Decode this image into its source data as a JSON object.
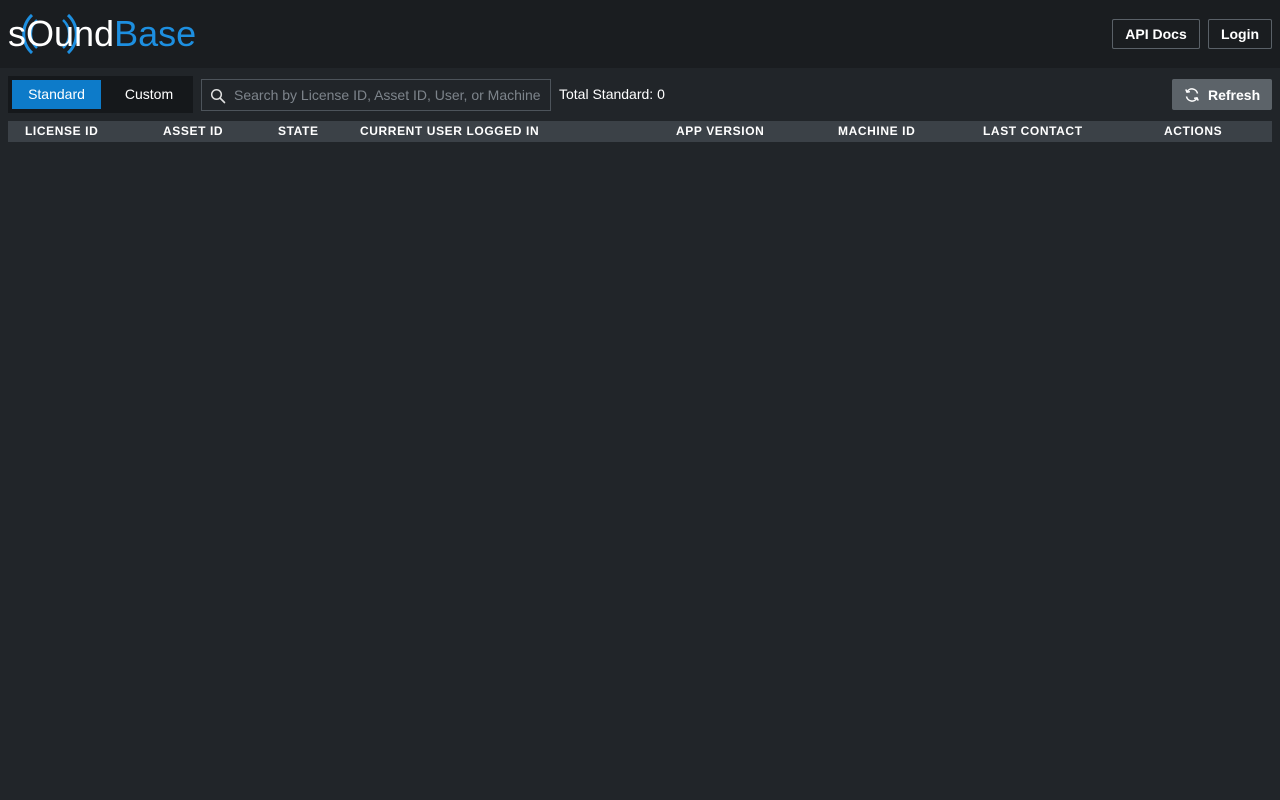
{
  "header": {
    "logo": {
      "part1": "s",
      "part2": "O",
      "part3": "und",
      "part4": "Base",
      "brand_color": "#1d8fe0"
    },
    "api_docs_label": "API Docs",
    "login_label": "Login"
  },
  "toolbar": {
    "toggle": {
      "standard_label": "Standard",
      "custom_label": "Custom",
      "selected": "Standard",
      "accent": "#0d7bc9"
    },
    "search": {
      "placeholder": "Search by License ID, Asset ID, User, or Machine ID",
      "value": "",
      "icon": "search-icon"
    },
    "total": {
      "label": "Total Standard:",
      "count": "0"
    },
    "refresh": {
      "label": "Refresh",
      "icon": "refresh-icon"
    }
  },
  "table": {
    "columns": [
      "LICENSE ID",
      "ASSET ID",
      "STATE",
      "CURRENT USER LOGGED IN",
      "APP VERSION",
      "MACHINE ID",
      "LAST CONTACT",
      "ACTIONS"
    ],
    "rows": []
  }
}
